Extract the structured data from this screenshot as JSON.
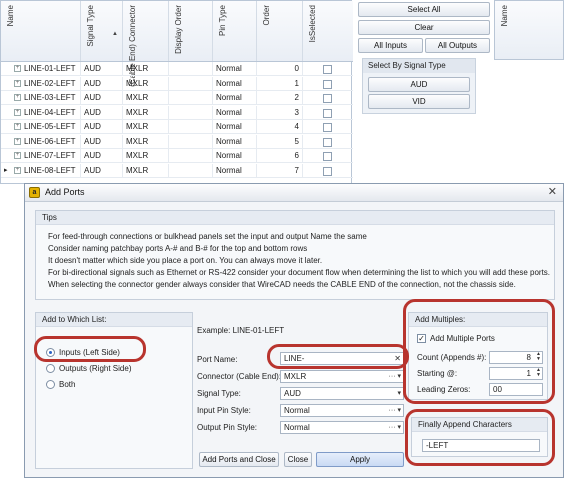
{
  "grid": {
    "headers": [
      "Name",
      "Signal Type",
      "(Cable End) Connector",
      "Display Order",
      "Pin Type",
      "Order",
      "IsSelected"
    ],
    "rows": [
      {
        "name": "LINE-01-LEFT",
        "signal": "AUD",
        "connector": "MXLR",
        "pin": "Normal",
        "order": "0"
      },
      {
        "name": "LINE-02-LEFT",
        "signal": "AUD",
        "connector": "MXLR",
        "pin": "Normal",
        "order": "1"
      },
      {
        "name": "LINE-03-LEFT",
        "signal": "AUD",
        "connector": "MXLR",
        "pin": "Normal",
        "order": "2"
      },
      {
        "name": "LINE-04-LEFT",
        "signal": "AUD",
        "connector": "MXLR",
        "pin": "Normal",
        "order": "3"
      },
      {
        "name": "LINE-05-LEFT",
        "signal": "AUD",
        "connector": "MXLR",
        "pin": "Normal",
        "order": "4"
      },
      {
        "name": "LINE-06-LEFT",
        "signal": "AUD",
        "connector": "MXLR",
        "pin": "Normal",
        "order": "5"
      },
      {
        "name": "LINE-07-LEFT",
        "signal": "AUD",
        "connector": "MXLR",
        "pin": "Normal",
        "order": "6"
      },
      {
        "name": "LINE-08-LEFT",
        "signal": "AUD",
        "connector": "MXLR",
        "pin": "Normal",
        "order": "7"
      }
    ]
  },
  "side": {
    "select_all": "Select All",
    "clear": "Clear",
    "all_inputs": "All Inputs",
    "all_outputs": "All Outputs",
    "group_title": "Select By Signal Type",
    "aud": "AUD",
    "vid": "VID",
    "right_grid_header": "Name"
  },
  "dialog": {
    "title": "Add Ports",
    "tips_title": "Tips",
    "tips": [
      "For feed-through connections or bulkhead panels set the input and output Name the same",
      "Consider naming patchbay ports A-# and B-# for the top and bottom rows",
      "It doesn't matter which side you place a port on. You can always move it later.",
      "For bi-directional signals such as Ethernet or RS-422 consider your document flow when determining the list to which you will add these ports.",
      "When selecting the connector gender always consider that WireCAD needs the CABLE END of the connection, not the chassis side."
    ],
    "list_title": "Add to Which List:",
    "opt_inputs": "Inputs (Left Side)",
    "opt_outputs": "Outputs (Right Side)",
    "opt_both": "Both",
    "example": "Example: LINE-01-LEFT",
    "port_name_label": "Port Name:",
    "port_name_value": "LINE-",
    "connector_label": "Connector (Cable End):",
    "connector_value": "MXLR",
    "signal_label": "Signal Type:",
    "signal_value": "AUD",
    "input_pin_label": "Input Pin Style:",
    "input_pin_value": "Normal",
    "output_pin_label": "Output Pin Style:",
    "output_pin_value": "Normal",
    "multiples_title": "Add Multiples:",
    "add_multiple_label": "Add Multiple Ports",
    "count_label": "Count (Appends #):",
    "count_value": "8",
    "starting_label": "Starting @:",
    "starting_value": "1",
    "zeros_label": "Leading Zeros:",
    "zeros_value": "00",
    "append_title": "Finally Append Characters",
    "append_value": "-LEFT",
    "btn_add_close": "Add Ports and Close",
    "btn_close": "Close",
    "btn_apply": "Apply"
  },
  "colors": {
    "highlight": "#b8342e",
    "accent": "#2a62c5"
  }
}
